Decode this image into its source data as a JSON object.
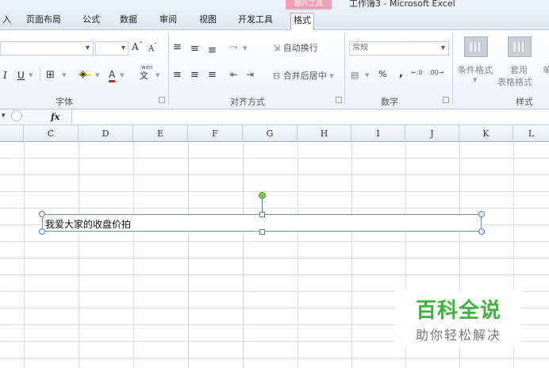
{
  "window": {
    "title": "工作簿3 - Microsoft Excel",
    "context_tab_group": "图片工具"
  },
  "tabs": [
    {
      "label": "入"
    },
    {
      "label": "页面布局"
    },
    {
      "label": "公式"
    },
    {
      "label": "数据"
    },
    {
      "label": "审阅"
    },
    {
      "label": "视图"
    },
    {
      "label": "开发工具"
    },
    {
      "label": "格式"
    }
  ],
  "ribbon": {
    "font_group": {
      "label": "字体",
      "font_size_value": "",
      "grow_font": "A",
      "shrink_font": "A",
      "italic": "I",
      "underline": "U",
      "border_icon": "border-icon",
      "fill_icon": "fill-color-icon",
      "font_color": "A",
      "phonetic": "wén"
    },
    "align_group": {
      "label": "对齐方式",
      "wrap_text": "自动换行",
      "merge_center": "合并后居中"
    },
    "number_group": {
      "label": "数字",
      "format_value": "常规",
      "percent": "%",
      "comma": ",",
      "inc_decimal": ".0",
      "dec_decimal": ".00"
    },
    "styles_group": {
      "label": "样式",
      "conditional_format": "条件格式",
      "table_format_line1": "套用",
      "table_format_line2": "表格格式",
      "cell_style": "单"
    }
  },
  "formula_bar": {
    "fx": "fx",
    "value": ""
  },
  "columns": [
    "C",
    "D",
    "E",
    "F",
    "G",
    "H",
    "I",
    "J",
    "K",
    "L"
  ],
  "textbox": {
    "text": "我爱大家的收盘价拍"
  },
  "watermark": {
    "title": "百科全说",
    "subtitle": "助你轻松解决"
  },
  "colors": {
    "ribbon_bg": "#eef2f7",
    "context_tab": "#f2a0b8",
    "rotation_handle": "#7ac943",
    "watermark_green": "#3eb13f"
  }
}
